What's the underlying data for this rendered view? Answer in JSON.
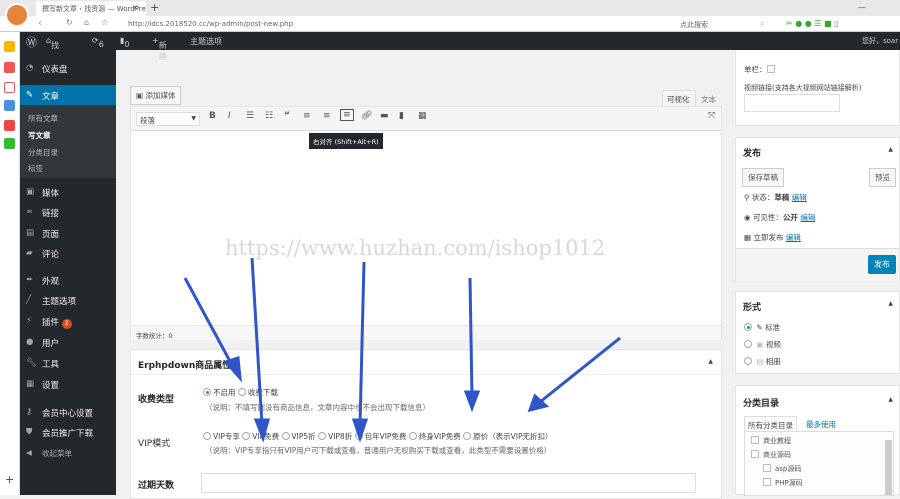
{
  "browser": {
    "tab_title": "撰写新文章 ‹ 找资源 — WordPress",
    "url": "http://idcs.2018520.cc/wp-admin/post-new.php",
    "search_placeholder": "点此搜索",
    "new_tab": "+",
    "close": "×"
  },
  "adminbar": {
    "site": "找资源",
    "updates": "6",
    "comments": "0",
    "new": "新建",
    "theme_options": "主题选项",
    "greeting": "您好，soar"
  },
  "menu": {
    "items": [
      {
        "icon": "dashboard-icon",
        "label": "仪表盘"
      },
      {
        "icon": "pin-icon",
        "label": "文章"
      },
      {
        "icon": "media-icon",
        "label": "媒体"
      },
      {
        "icon": "link-icon",
        "label": "链接"
      },
      {
        "icon": "page-icon",
        "label": "页面"
      },
      {
        "icon": "comment-icon",
        "label": "评论"
      },
      {
        "icon": "appearance-icon",
        "label": "外观"
      },
      {
        "icon": "brush-icon",
        "label": "主题选项"
      },
      {
        "icon": "plugin-icon",
        "label": "插件",
        "badge": "2"
      },
      {
        "icon": "user-icon",
        "label": "用户"
      },
      {
        "icon": "wrench-icon",
        "label": "工具"
      },
      {
        "icon": "settings-icon",
        "label": "设置"
      },
      {
        "icon": "key-icon",
        "label": "会员中心设置"
      },
      {
        "icon": "shield-icon",
        "label": "会员推广下载"
      },
      {
        "icon": "collapse-icon",
        "label": "收起菜单"
      }
    ],
    "sub": [
      "所有文章",
      "写文章",
      "分类目录",
      "标签"
    ]
  },
  "editor": {
    "add_media": "添加媒体",
    "tab_visual": "可视化",
    "tab_text": "文本",
    "format": "段落",
    "tooltip": "右对齐 (Shift+Alt+R)",
    "word_count": "字数统计：0"
  },
  "watermark": "https://www.huzhan.com/ishop1012",
  "erphp": {
    "title": "Erphpdown商品属性",
    "fee_label": "收费类型",
    "fee_options": [
      "不启用",
      "收费下载"
    ],
    "fee_note": "（说明：不填写则没有商品信息，文章内容中也不会出现下载信息）",
    "vip_label": "VIP模式",
    "vip_options": [
      "VIP专享",
      "VIP免费",
      "VIP5折",
      "VIP8折",
      "包年VIP免费",
      "终身VIP免费",
      "原价（表示VIP无折扣）"
    ],
    "vip_note": "（说明：VIP专享指只有VIP用户可下载或查看，普通用户无权购买下载或查看，此类型不需要设置价格）",
    "expire_label": "过期天数"
  },
  "side_top": {
    "column_label": "单栏：",
    "video_label": "视频链接(支持各大视频网站链接解析)"
  },
  "publish": {
    "title": "发布",
    "save_draft": "保存草稿",
    "preview": "预览",
    "status_label": "状态：",
    "status": "草稿",
    "visibility_label": "可见性：",
    "visibility": "公开",
    "publish_label": "立即发布",
    "edit": "编辑",
    "publish_button": "发布"
  },
  "format": {
    "title": "形式",
    "options": [
      "标准",
      "视频",
      "相册"
    ]
  },
  "categories": {
    "title": "分类目录",
    "tab_all": "所有分类目录",
    "tab_popular": "最多使用",
    "items": [
      "商业教程",
      "商业源码",
      "asp源码",
      "PHP源码"
    ]
  },
  "colors": {
    "accent": "#0073aa",
    "adminbar": "#23282d",
    "arrow": "#2f55c8"
  }
}
